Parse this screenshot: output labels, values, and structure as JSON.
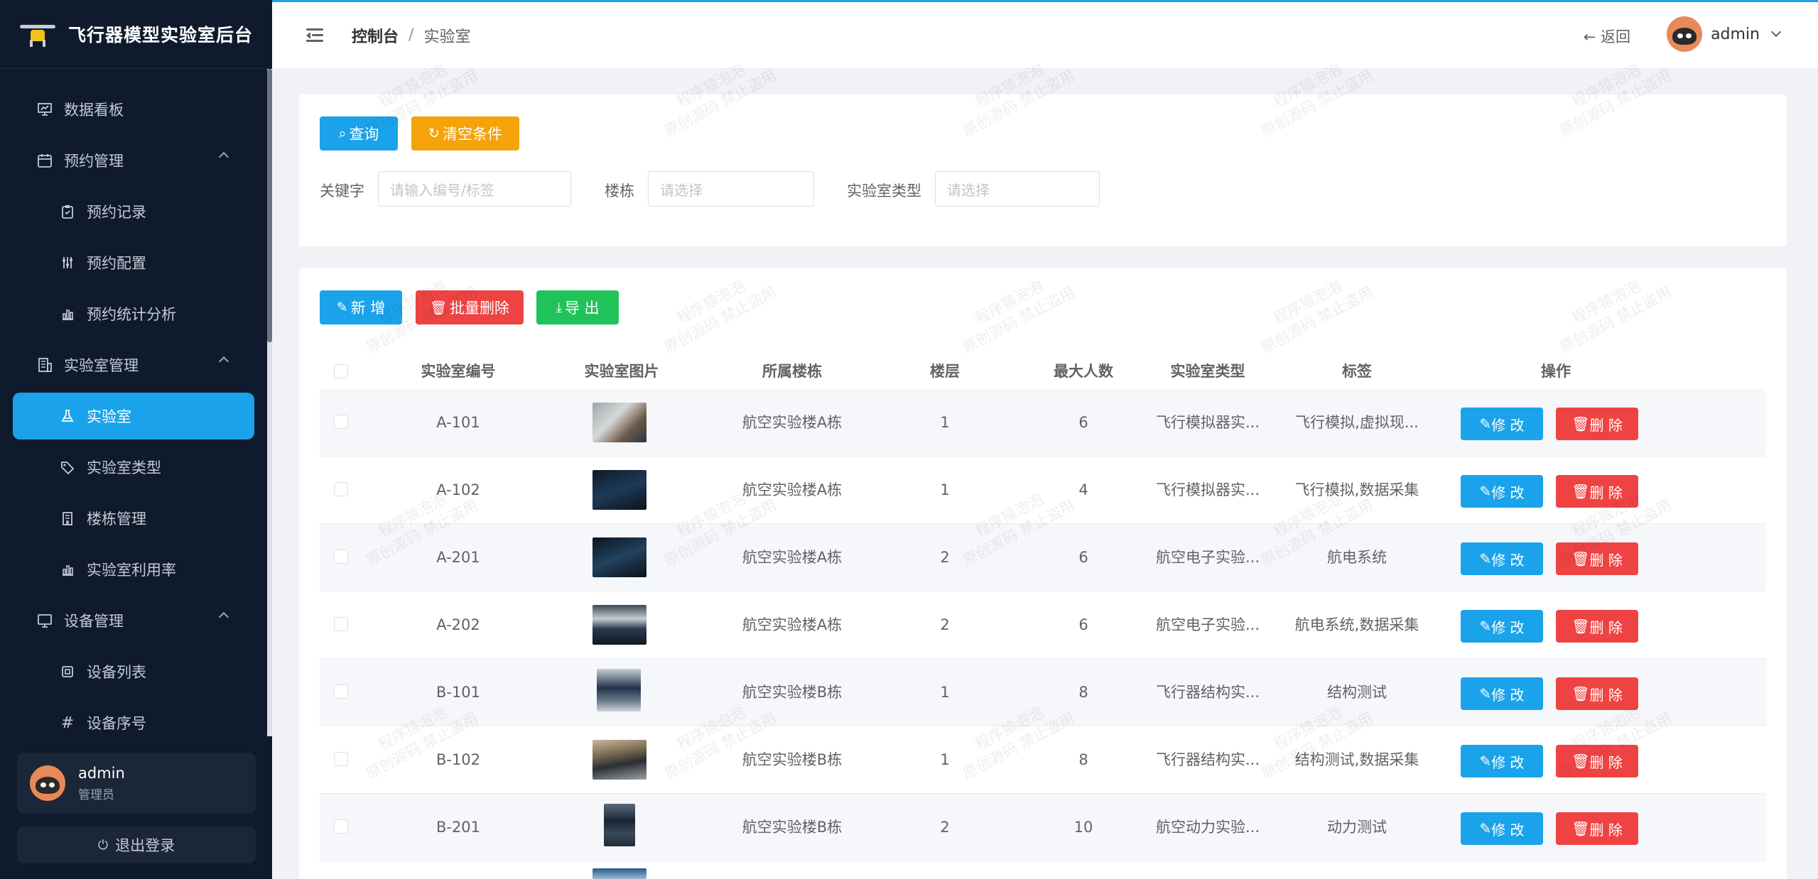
{
  "app": {
    "title": "飞行器模型实验室后台"
  },
  "sidebar": {
    "items": [
      {
        "label": "数据看板",
        "icon": "dashboard-icon",
        "level": 1
      },
      {
        "label": "预约管理",
        "icon": "calendar-icon",
        "level": 1,
        "expanded": true
      },
      {
        "label": "预约记录",
        "icon": "clipboard-icon",
        "level": 2
      },
      {
        "label": "预约配置",
        "icon": "sliders-icon",
        "level": 2
      },
      {
        "label": "预约统计分析",
        "icon": "bar-chart-icon",
        "level": 2
      },
      {
        "label": "实验室管理",
        "icon": "building-icon",
        "level": 1,
        "expanded": true
      },
      {
        "label": "实验室",
        "icon": "flask-icon",
        "level": 2,
        "active": true
      },
      {
        "label": "实验室类型",
        "icon": "tag-icon",
        "level": 2
      },
      {
        "label": "楼栋管理",
        "icon": "building-icon",
        "level": 2
      },
      {
        "label": "实验室利用率",
        "icon": "bar-chart-icon",
        "level": 2
      },
      {
        "label": "设备管理",
        "icon": "monitor-icon",
        "level": 1,
        "expanded": true
      },
      {
        "label": "设备列表",
        "icon": "device-icon",
        "level": 2
      },
      {
        "label": "设备序号",
        "icon": "hash-icon",
        "level": 2
      }
    ],
    "user": {
      "name": "admin",
      "role": "管理员"
    },
    "logout_label": "退出登录"
  },
  "header": {
    "breadcrumb": [
      "控制台",
      "实验室"
    ],
    "back_label": "返回",
    "user_name": "admin"
  },
  "filter": {
    "query_label": "查询",
    "clear_label": "清空条件",
    "keyword_label": "关键字",
    "keyword_placeholder": "请输入编号/标签",
    "building_label": "楼栋",
    "building_placeholder": "请选择",
    "type_label": "实验室类型",
    "type_placeholder": "请选择"
  },
  "toolbar": {
    "add_label": "新 增",
    "batch_delete_label": "批量删除",
    "export_label": "导 出"
  },
  "table": {
    "columns": [
      "实验室编号",
      "实验室图片",
      "所属楼栋",
      "楼层",
      "最大人数",
      "实验室类型",
      "标签",
      "操作"
    ],
    "edit_label": "修 改",
    "delete_label": "删 除",
    "rows": [
      {
        "code": "A-101",
        "building": "航空实验楼A栋",
        "floor": "1",
        "max": "6",
        "type": "飞行模拟器实...",
        "tags": "飞行模拟,虚拟现..."
      },
      {
        "code": "A-102",
        "building": "航空实验楼A栋",
        "floor": "1",
        "max": "4",
        "type": "飞行模拟器实...",
        "tags": "飞行模拟,数据采集"
      },
      {
        "code": "A-201",
        "building": "航空实验楼A栋",
        "floor": "2",
        "max": "6",
        "type": "航空电子实验...",
        "tags": "航电系统"
      },
      {
        "code": "A-202",
        "building": "航空实验楼A栋",
        "floor": "2",
        "max": "6",
        "type": "航空电子实验...",
        "tags": "航电系统,数据采集"
      },
      {
        "code": "B-101",
        "building": "航空实验楼B栋",
        "floor": "1",
        "max": "8",
        "type": "飞行器结构实...",
        "tags": "结构测试"
      },
      {
        "code": "B-102",
        "building": "航空实验楼B栋",
        "floor": "1",
        "max": "8",
        "type": "飞行器结构实...",
        "tags": "结构测试,数据采集"
      },
      {
        "code": "B-201",
        "building": "航空实验楼B栋",
        "floor": "2",
        "max": "10",
        "type": "航空动力实验...",
        "tags": "动力测试"
      }
    ]
  },
  "watermark": {
    "line1": "程序猿泡泡",
    "line2": "原创源码 禁止盗用"
  },
  "colors": {
    "accent": "#1aa3ea",
    "danger": "#ef4343",
    "warning": "#f5a30b",
    "success": "#1fc35a",
    "sidebar_bg": "#0f1b2d"
  }
}
